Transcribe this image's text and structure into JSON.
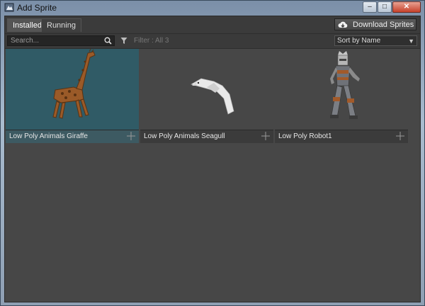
{
  "window": {
    "title": "Add Sprite"
  },
  "tabs": [
    {
      "label": "Installed"
    },
    {
      "label": "Running"
    }
  ],
  "download_button": {
    "label": "Download Sprites"
  },
  "search": {
    "placeholder": "Search..."
  },
  "filter": {
    "text": "Filter : All 3"
  },
  "sort": {
    "selected": "Sort by Name"
  },
  "sprites": [
    {
      "name": "Low Poly Animals Giraffe"
    },
    {
      "name": "Low Poly Animals Seagull"
    },
    {
      "name": "Low Poly Robot1"
    }
  ],
  "colors": {
    "accent_selected": "#305b66",
    "panel": "#474747",
    "close_button": "#c6412a"
  }
}
